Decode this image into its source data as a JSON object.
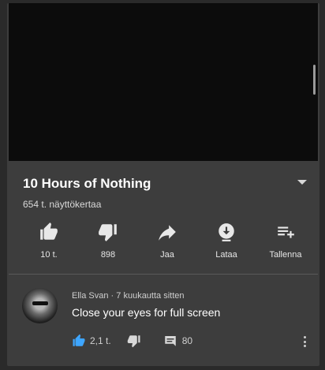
{
  "video": {
    "title": "10 Hours of Nothing",
    "views": "654 t. näyttökertaa"
  },
  "actions": [
    {
      "icon": "thumb-up-icon",
      "label": "10 t."
    },
    {
      "icon": "thumb-down-icon",
      "label": "898"
    },
    {
      "icon": "share-icon",
      "label": "Jaa"
    },
    {
      "icon": "download-icon",
      "label": "Lataa"
    },
    {
      "icon": "add-to-playlist-icon",
      "label": "Tallenna"
    }
  ],
  "comment": {
    "author": "Ella Svan",
    "time": "7 kuukautta sitten",
    "separator": "·",
    "text": "Close your eyes for full screen",
    "likes": "2,1 t.",
    "replies": "80"
  },
  "colors": {
    "background": "#3d3d3d",
    "video": "#0c0c0c",
    "like_active": "#3ea6ff"
  }
}
